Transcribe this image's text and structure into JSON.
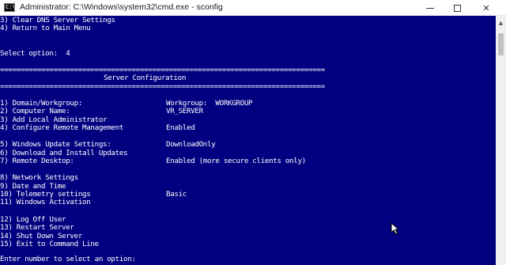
{
  "window": {
    "title": "Administrator: C:\\Windows\\system32\\cmd.exe - sconfig",
    "icon_name": "cmd-icon",
    "icon_text": "C:\\",
    "minimize_icon": "minimize-icon",
    "maximize_icon": "maximize-icon",
    "close_glyph": "✕",
    "colors": {
      "console_bg": "#000080",
      "text": "#ffffff",
      "titlebar_bg": "#ffffff"
    }
  },
  "console": {
    "pre_lines": [
      "3) Clear DNS Server Settings",
      "4) Return to Main Menu"
    ],
    "select_prompt": "Select option:  4",
    "separator": "===============================================================================",
    "header_title": "Server Configuration",
    "menu": [
      {
        "label": "1) Domain/Workgroup:",
        "value": "Workgroup:  WORKGROUP"
      },
      {
        "label": "2) Computer Name:",
        "value": "VR_SERVER"
      },
      {
        "label": "3) Add Local Administrator",
        "value": ""
      },
      {
        "label": "4) Configure Remote Management",
        "value": "Enabled"
      },
      {
        "label": "5) Windows Update Settings:",
        "value": "DownloadOnly"
      },
      {
        "label": "6) Download and Install Updates",
        "value": ""
      },
      {
        "label": "7) Remote Desktop:",
        "value": "Enabled (more secure clients only)"
      },
      {
        "label": "8) Network Settings",
        "value": ""
      },
      {
        "label": "9) Date and Time",
        "value": ""
      },
      {
        "label": "10) Telemetry settings",
        "value": "Basic"
      },
      {
        "label": "11) Windows Activation",
        "value": ""
      },
      {
        "label": "12) Log Off User",
        "value": ""
      },
      {
        "label": "13) Restart Server",
        "value": ""
      },
      {
        "label": "14) Shut Down Server",
        "value": ""
      },
      {
        "label": "15) Exit to Command Line",
        "value": ""
      }
    ],
    "input_prompt": "Enter number to select an option:"
  },
  "scrollbar": {
    "up_glyph": "▲"
  }
}
